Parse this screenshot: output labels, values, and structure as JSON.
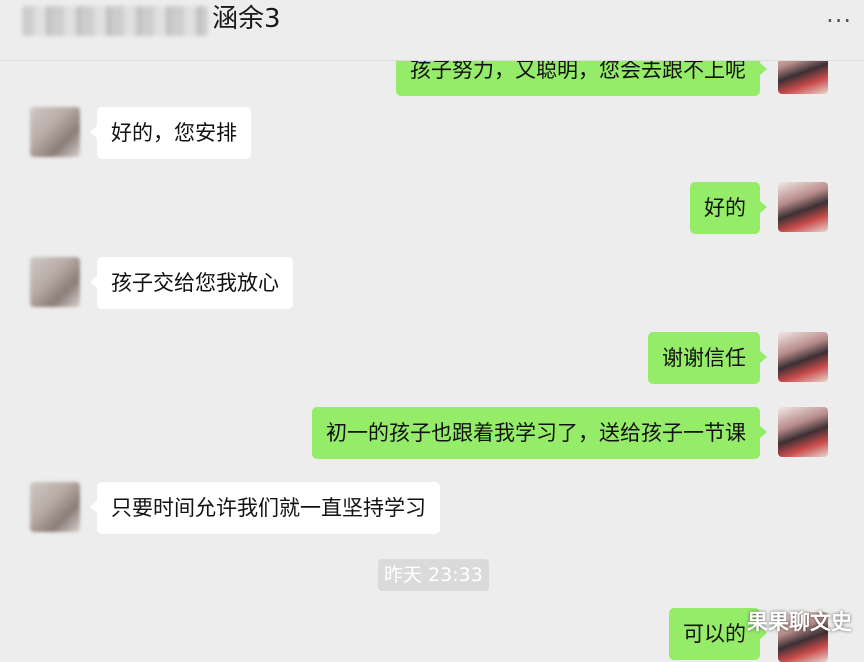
{
  "header": {
    "title": "涵余3",
    "more_glyph": "···"
  },
  "messages": [
    {
      "side": "out",
      "text": "孩子努力，又聪明，您会去跟不上呢"
    },
    {
      "side": "in",
      "text": "好的，您安排"
    },
    {
      "side": "out",
      "text": "好的"
    },
    {
      "side": "in",
      "text": "孩子交给您我放心"
    },
    {
      "side": "out",
      "text": "谢谢信任"
    },
    {
      "side": "out",
      "text": "初一的孩子也跟着我学习了，送给孩子一节课"
    },
    {
      "side": "in",
      "text": "只要时间允许我们就一直坚持学习"
    },
    {
      "side": "out",
      "text": "可以的"
    }
  ],
  "timestamp": "昨天 23:33",
  "watermark": "果果聊文史",
  "colors": {
    "background": "#ededed",
    "incoming_bubble": "#ffffff",
    "outgoing_bubble": "#95ec69"
  }
}
